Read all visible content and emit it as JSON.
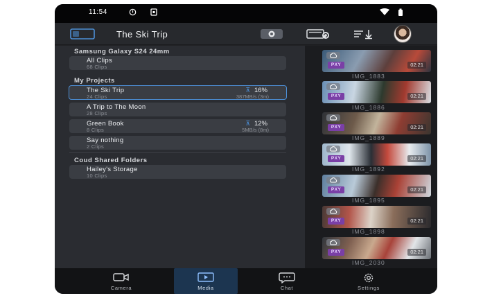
{
  "status_bar": {
    "time": "11:54"
  },
  "header": {
    "title": "The Ski Trip"
  },
  "device_section": {
    "heading": "Samsung Galaxy S24 24mm",
    "items": [
      {
        "name": "All Clips",
        "count": "68 Clips"
      }
    ]
  },
  "projects_section": {
    "heading": "My Projects",
    "items": [
      {
        "name": "The Ski Trip",
        "count": "24 Clips",
        "progress": "16%",
        "speed": "387MB/s (3m)",
        "selected": true
      },
      {
        "name": "A Trip to The Moon",
        "count": "28 Clips"
      },
      {
        "name": "Green Book",
        "count": "8 Clips",
        "progress": "12%",
        "speed": "5MB/s (8m)"
      },
      {
        "name": "Say nothing",
        "count": "2 Clips"
      }
    ]
  },
  "cloud_section": {
    "heading": "Coud Shared Folders",
    "items": [
      {
        "name": "Hailey's Storage",
        "count": "10 Clips"
      }
    ]
  },
  "media_grid": {
    "badge": "PXY",
    "clips": [
      {
        "name": "IMG_1883",
        "duration": "02:21"
      },
      {
        "name": "IMG_1886",
        "duration": "02:21"
      },
      {
        "name": "IMG_1889",
        "duration": "02:21"
      },
      {
        "name": "IMG_1892",
        "duration": "02:21"
      },
      {
        "name": "IMG_1895",
        "duration": "02:21"
      },
      {
        "name": "IMG_1898",
        "duration": "02:21"
      },
      {
        "name": "IMG_2030",
        "duration": "02:21"
      }
    ]
  },
  "bottom_nav": {
    "items": [
      {
        "label": "Camera",
        "icon": "camera-icon"
      },
      {
        "label": "Media",
        "icon": "media-icon",
        "active": true
      },
      {
        "label": "Chat",
        "icon": "chat-icon"
      },
      {
        "label": "Settings",
        "icon": "settings-icon"
      }
    ]
  },
  "colors": {
    "accent": "#4d8fd6",
    "panel_bg": "#2a2c31",
    "item_bg": "#3a3d43",
    "proxy_badge": "#7a3fa6",
    "nav_active_bg": "#1c3550"
  }
}
